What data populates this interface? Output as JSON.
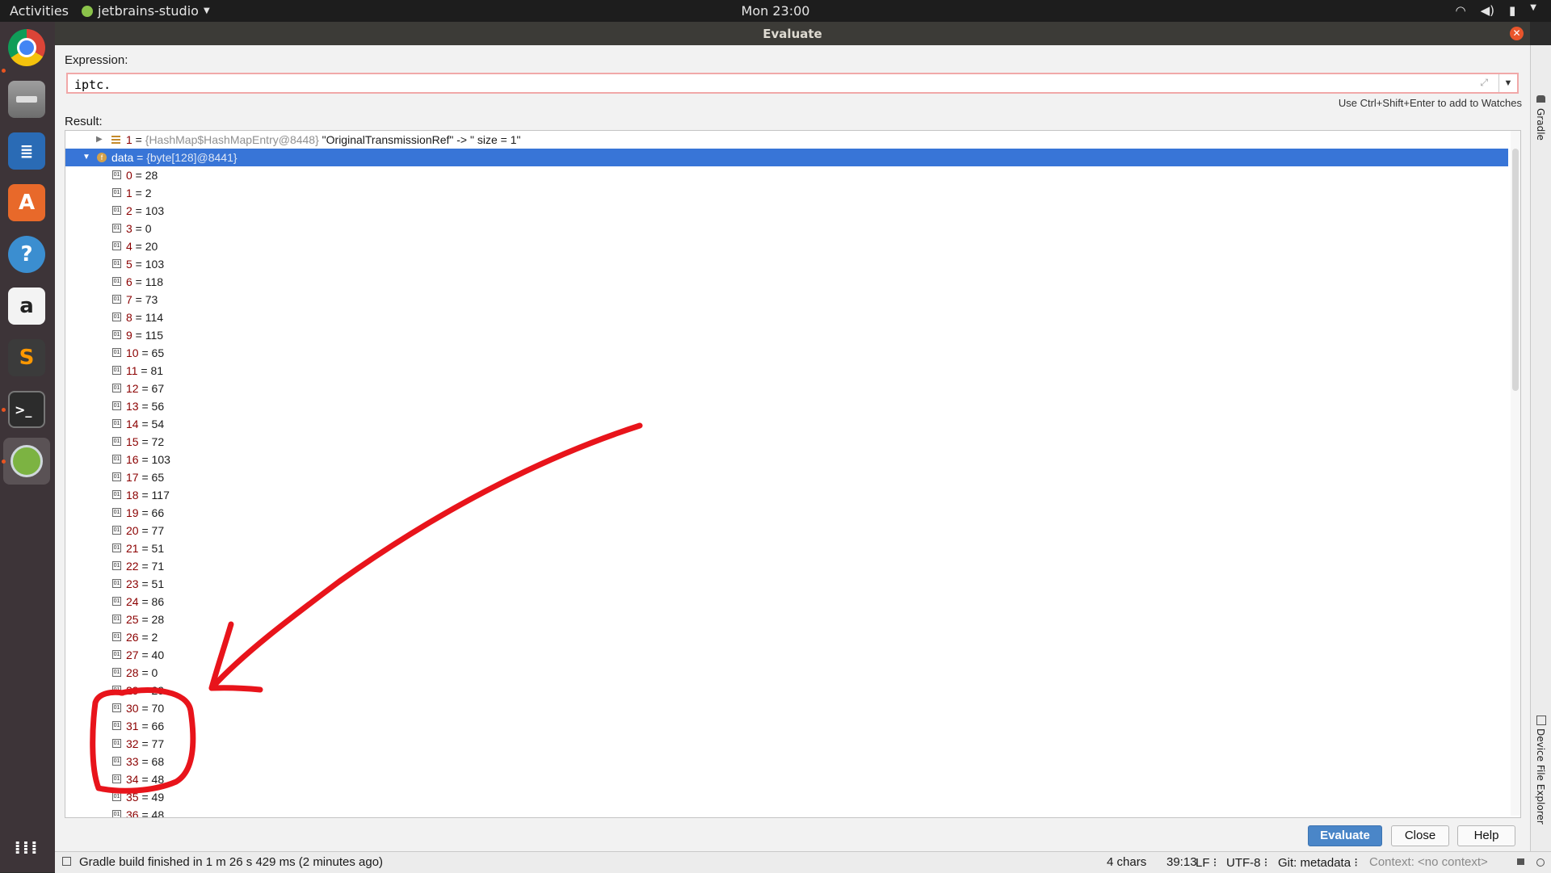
{
  "topbar": {
    "activities": "Activities",
    "app_name": "jetbrains-studio",
    "clock": "Mon 23:00"
  },
  "window": {
    "title": "Evaluate"
  },
  "dialog": {
    "expression_label": "Expression:",
    "expression_value": "iptc.",
    "hint": "Use Ctrl+Shift+Enter to add to Watches",
    "result_label": "Result:",
    "tree": {
      "entry_row": {
        "key": "1",
        "eq": " = ",
        "ref": "{HashMap$HashMapEntry@8448}",
        "value": " \"OriginalTransmissionRef\" -> \" size = 1\""
      },
      "data_row": {
        "key": "data",
        "eq": " = ",
        "value": "{byte[128]@8441}"
      },
      "items": [
        {
          "i": "0",
          "v": "28"
        },
        {
          "i": "1",
          "v": "2"
        },
        {
          "i": "2",
          "v": "103"
        },
        {
          "i": "3",
          "v": "0"
        },
        {
          "i": "4",
          "v": "20"
        },
        {
          "i": "5",
          "v": "103"
        },
        {
          "i": "6",
          "v": "118"
        },
        {
          "i": "7",
          "v": "73"
        },
        {
          "i": "8",
          "v": "114"
        },
        {
          "i": "9",
          "v": "115"
        },
        {
          "i": "10",
          "v": "65"
        },
        {
          "i": "11",
          "v": "81"
        },
        {
          "i": "12",
          "v": "67"
        },
        {
          "i": "13",
          "v": "56"
        },
        {
          "i": "14",
          "v": "54"
        },
        {
          "i": "15",
          "v": "72"
        },
        {
          "i": "16",
          "v": "103"
        },
        {
          "i": "17",
          "v": "65"
        },
        {
          "i": "18",
          "v": "117"
        },
        {
          "i": "19",
          "v": "66"
        },
        {
          "i": "20",
          "v": "77"
        },
        {
          "i": "21",
          "v": "51"
        },
        {
          "i": "22",
          "v": "71"
        },
        {
          "i": "23",
          "v": "51"
        },
        {
          "i": "24",
          "v": "86"
        },
        {
          "i": "25",
          "v": "28"
        },
        {
          "i": "26",
          "v": "2"
        },
        {
          "i": "27",
          "v": "40"
        },
        {
          "i": "28",
          "v": "0"
        },
        {
          "i": "29",
          "v": "29"
        },
        {
          "i": "30",
          "v": "70"
        },
        {
          "i": "31",
          "v": "66"
        },
        {
          "i": "32",
          "v": "77"
        },
        {
          "i": "33",
          "v": "68"
        },
        {
          "i": "34",
          "v": "48"
        },
        {
          "i": "35",
          "v": "49"
        },
        {
          "i": "36",
          "v": "48"
        }
      ]
    },
    "buttons": {
      "evaluate": "Evaluate",
      "close": "Close",
      "help": "Help"
    }
  },
  "right_strip": {
    "gradle": "Gradle",
    "device_file_explorer": "Device File Explorer"
  },
  "statusbar": {
    "message": "Gradle build finished in 1 m 26 s 429 ms (2 minutes ago)",
    "chars": "4 chars",
    "position": "39:13",
    "line_sep": "LF ⁝",
    "encoding": "UTF-8 ⁝",
    "git": "Git: metadata ⁝",
    "context": "Context: <no context>"
  },
  "colors": {
    "selection": "#3875d7",
    "annotation": "#e8141b",
    "ubuntu_orange": "#e95420"
  }
}
